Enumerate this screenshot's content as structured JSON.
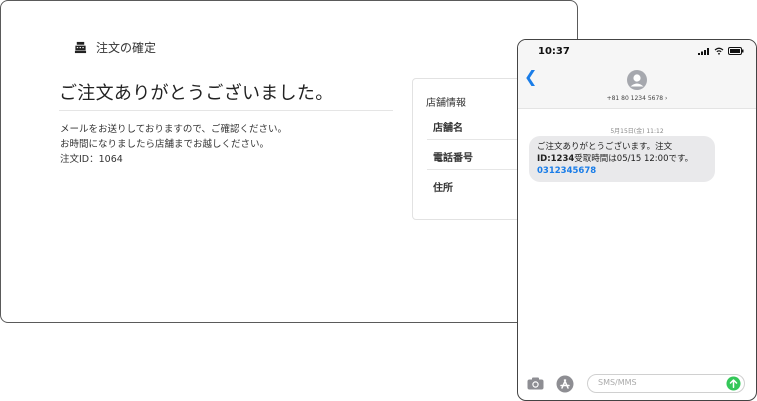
{
  "desktop": {
    "page_title": "注文の確定",
    "headline": "ご注文ありがとうございました。",
    "message_lines": [
      "メールをお送りしておりますので、ご確認ください。",
      "お時間になりましたら店舗までお越しください。",
      "注文ID：1064"
    ],
    "store_card": {
      "title": "店舗情報",
      "rows": [
        "店舗名",
        "電話番号",
        "住所"
      ]
    }
  },
  "phone": {
    "time": "10:37",
    "sender": "+81 80 1234 5678 ›",
    "timestamp": "5月15日(金) 11:12",
    "message": {
      "line1": "ご注文ありがとうございます。注文",
      "id_prefix": "ID:",
      "id_value": "1234",
      "line2": "受取時間は05/15 12:00です。",
      "phone_link": "0312345678"
    },
    "composer_placeholder": "SMS/MMS"
  }
}
